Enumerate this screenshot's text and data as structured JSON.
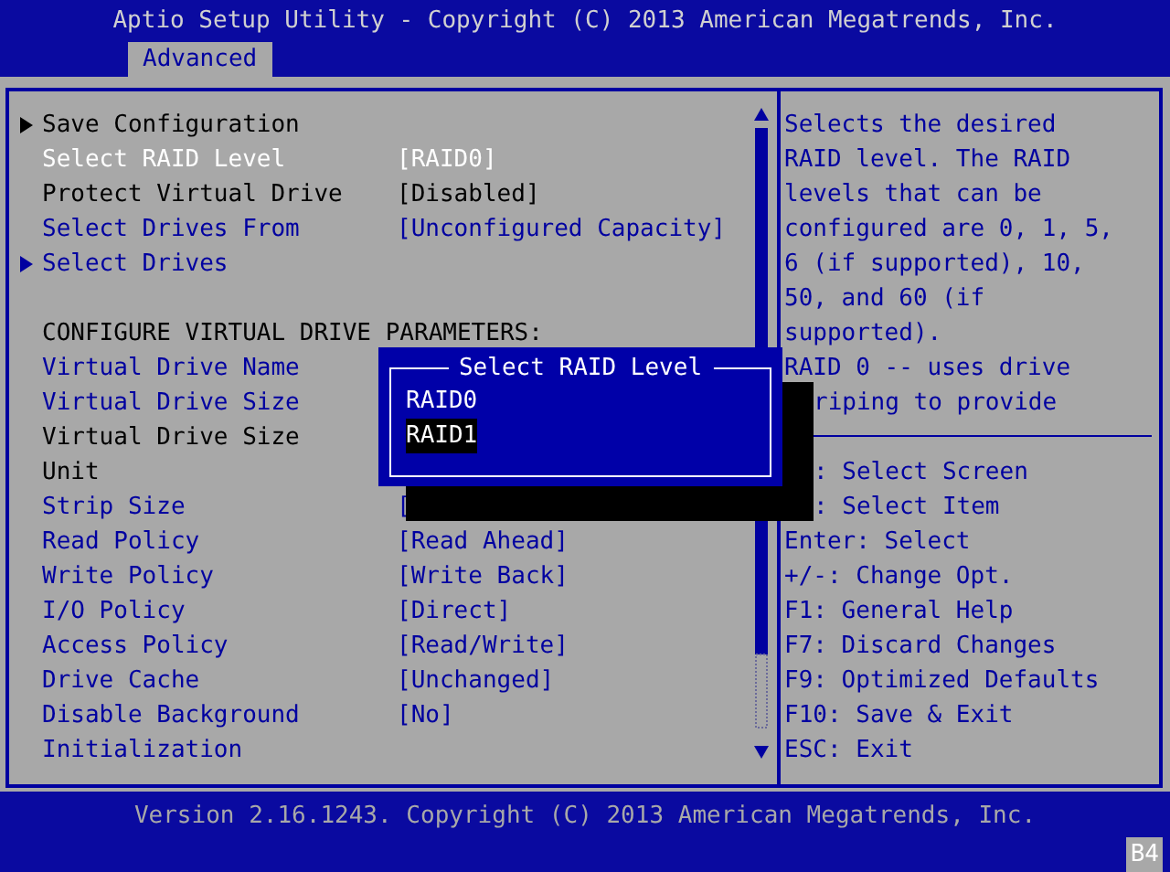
{
  "header": {
    "title": "Aptio Setup Utility - Copyright (C) 2013 American Megatrends, Inc.",
    "tabs": [
      {
        "label": "Advanced",
        "selected": true
      }
    ]
  },
  "settings": [
    {
      "kind": "submenu",
      "label": "Save Configuration",
      "selected": false,
      "disabled": true
    },
    {
      "kind": "setting",
      "label": "Select RAID Level",
      "value": "[RAID0]",
      "selected": true,
      "disabled": false
    },
    {
      "kind": "setting",
      "label": "Protect Virtual Drive",
      "value": "[Disabled]",
      "selected": false,
      "disabled": true
    },
    {
      "kind": "setting",
      "label": "Select Drives From",
      "value": "[Unconfigured Capacity]",
      "selected": false,
      "disabled": false
    },
    {
      "kind": "submenu",
      "label": "Select Drives",
      "selected": false,
      "disabled": false
    },
    {
      "kind": "heading",
      "label": "CONFIGURE VIRTUAL DRIVE PARAMETERS:",
      "selected": false,
      "disabled": true
    },
    {
      "kind": "setting",
      "label": "Virtual Drive Name",
      "selected": false,
      "disabled": false
    },
    {
      "kind": "setting",
      "label": "Virtual Drive Size",
      "selected": false,
      "disabled": false
    },
    {
      "kind": "setting",
      "label": "Virtual Drive Size",
      "selected": false,
      "disabled": true
    },
    {
      "kind": "setting",
      "label": "Unit",
      "selected": false,
      "disabled": true
    },
    {
      "kind": "setting",
      "label": "Strip Size",
      "value": "[",
      "selected": false,
      "disabled": false
    },
    {
      "kind": "setting",
      "label": "Read Policy",
      "value": "[Read Ahead]",
      "selected": false,
      "disabled": false
    },
    {
      "kind": "setting",
      "label": "Write Policy",
      "value": "[Write Back]",
      "selected": false,
      "disabled": false
    },
    {
      "kind": "setting",
      "label": "I/O Policy",
      "value": "[Direct]",
      "selected": false,
      "disabled": false
    },
    {
      "kind": "setting",
      "label": "Access Policy",
      "value": "[Read/Write]",
      "selected": false,
      "disabled": false
    },
    {
      "kind": "setting",
      "label": "Drive Cache",
      "value": "[Unchanged]",
      "selected": false,
      "disabled": false
    },
    {
      "kind": "setting",
      "label": "Disable Background",
      "value": "[No]",
      "selected": false,
      "disabled": false
    },
    {
      "kind": "setting",
      "label": "Initialization",
      "selected": false,
      "disabled": false
    }
  ],
  "popup": {
    "title": "Select RAID Level",
    "options": [
      {
        "label": "RAID0",
        "selected": false
      },
      {
        "label": "RAID1",
        "selected": true
      }
    ]
  },
  "help": {
    "lines": [
      {
        "text": "Selects the desired",
        "covered": false
      },
      {
        "text": "RAID level. The RAID",
        "covered": false
      },
      {
        "text": "levels that can be",
        "covered": false
      },
      {
        "text": "configured are 0, 1, 5,",
        "covered": false
      },
      {
        "text": "6 (if supported), 10,",
        "covered": false
      },
      {
        "text": "50, and 60 (if",
        "covered": false
      },
      {
        "text": "supported).",
        "covered": false
      },
      {
        "text": "RAID 0 -- uses drive",
        "covered": false
      },
      {
        "text": "riping to provide",
        "covered": true
      }
    ],
    "keys": [
      {
        "text": ": Select Screen",
        "covered": true
      },
      {
        "text": ": Select Item",
        "covered": true
      },
      {
        "text": "Enter: Select",
        "covered": false
      },
      {
        "text": "+/-: Change Opt.",
        "covered": false
      },
      {
        "text": "F1: General Help",
        "covered": false
      },
      {
        "text": "F7: Discard Changes",
        "covered": false
      },
      {
        "text": "F9: Optimized Defaults",
        "covered": false
      },
      {
        "text": "F10: Save & Exit",
        "covered": false
      },
      {
        "text": "ESC: Exit",
        "covered": false
      }
    ]
  },
  "footer": {
    "version": "Version 2.16.1243. Copyright (C) 2013 American Megatrends, Inc.",
    "badge": "B4"
  }
}
